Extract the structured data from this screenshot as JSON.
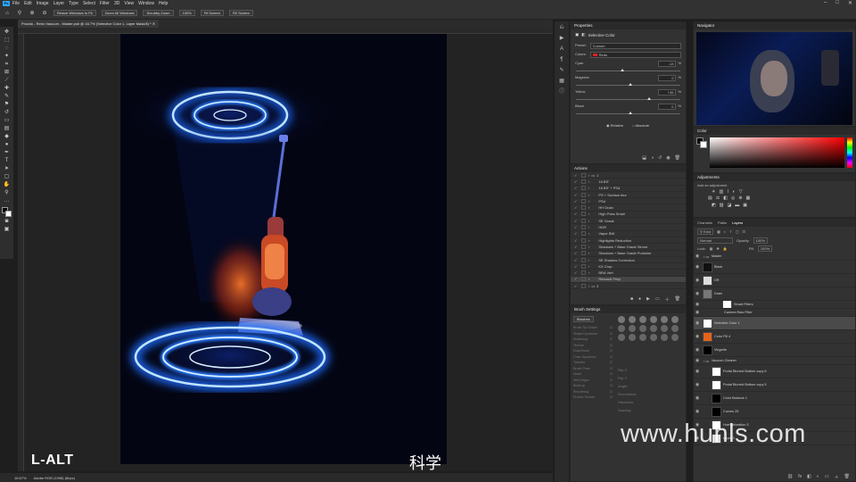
{
  "menubar": {
    "app_icon": "Ps",
    "items": [
      "File",
      "Edit",
      "Image",
      "Layer",
      "Type",
      "Select",
      "Filter",
      "3D",
      "View",
      "Window",
      "Help"
    ]
  },
  "window_controls": [
    "–",
    "□",
    "✕"
  ],
  "options_bar": {
    "buttons": [
      "Resize Windows to Fit",
      "Zoom All Windows",
      "Scrubby Zoom",
      "100%",
      "Fit Screen",
      "Fill Screen"
    ]
  },
  "document_tab": {
    "label": "Procisk - Retro Vacuum - Master.psb @ 16.7% (Selective Color 1, Layer Mask/8) *"
  },
  "status_bar": {
    "zoom": "16.67%",
    "info": "Adobe RGB (1998) (8bpc)"
  },
  "properties": {
    "title": "Properties",
    "adjustment": "Selective Color",
    "preset_label": "Preset:",
    "preset_value": "Custom",
    "colors_label": "Colors:",
    "colors_value": "Reds",
    "sliders": [
      {
        "label": "Cyan",
        "value": "-13",
        "unit": "%",
        "pos": 0.43
      },
      {
        "label": "Magenta",
        "value": "0",
        "unit": "%",
        "pos": 0.5
      },
      {
        "label": "Yellow",
        "value": "+36",
        "unit": "%",
        "pos": 0.68
      },
      {
        "label": "Black",
        "value": "0",
        "unit": "%",
        "pos": 0.5
      }
    ],
    "relative_label": "Relative",
    "absolute_label": "Absolute"
  },
  "actions": {
    "title": "Actions",
    "items": [
      "1",
      "16 BIT",
      "16 BIT + PSd",
      "PS + Surface blur",
      "PSd",
      "HH Drain",
      "High Pass Small",
      "SE Grads",
      "HDR",
      "Vapor BW",
      "Highlights Reduction",
      "Shadows + Base Grade Sinner",
      "Shadows + Base Grade Punisher",
      "SE Shadow Correction",
      "KX Crop",
      "BRA Vert",
      "Retouch Prep",
      "2"
    ]
  },
  "brush_settings": {
    "title": "Brush Settings",
    "brushes_button": "Brushes",
    "options": [
      "Brush Tip Shape",
      "Shape Dynamics",
      "Scattering",
      "Texture",
      "Dual Brush",
      "Color Dynamics",
      "Transfer",
      "Brush Pose",
      "Noise",
      "Wet Edges",
      "Build-up",
      "Smoothing",
      "Protect Texture"
    ],
    "labels": [
      "Flip X",
      "Flip Y",
      "Angle:",
      "Roundness:",
      "Hardness",
      "Spacing"
    ]
  },
  "navigator": {
    "title": "Navigator"
  },
  "color_panel": {
    "title": "Color"
  },
  "adjustments": {
    "title": "Adjustments",
    "subtitle": "Add an adjustment"
  },
  "layers": {
    "tabs": [
      "Channels",
      "Paths",
      "Layers"
    ],
    "kind_label": "Kind",
    "blend_mode": "Normal",
    "opacity_label": "Opacity:",
    "opacity_value": "100%",
    "lock_label": "Lock:",
    "fill_label": "Fill:",
    "fill_value": "100%",
    "rows": [
      "Master",
      "Black",
      "DR",
      "Drain",
      "Smart Filters",
      "Camera Raw Filter",
      "Selective Color 1",
      "Color Fill 4",
      "Vingette",
      "Vacuum Cleaner",
      "Portal Blurred Bottom copy 6",
      "Portal Blurred Bottom copy 5",
      "Color Balance 1",
      "Curves 25",
      "Hue/Saturation 3",
      "Layer 3"
    ]
  },
  "overlays": {
    "key_hint": "L-ALT",
    "subtitle": "科学",
    "watermark": "www.hunls.com"
  }
}
